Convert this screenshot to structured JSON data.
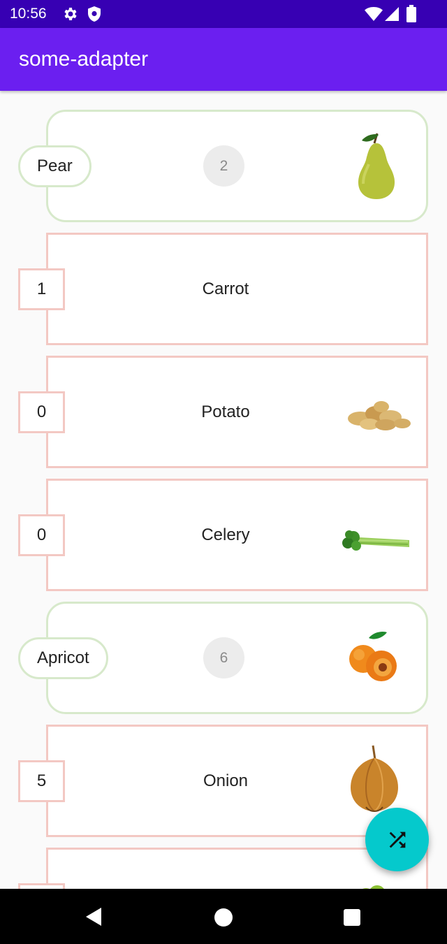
{
  "status_bar": {
    "time": "10:56"
  },
  "app_bar": {
    "title": "some-adapter"
  },
  "list": {
    "pear": {
      "tag": "Pear",
      "count": "2",
      "icon": "pear-image"
    },
    "carrot": {
      "tag": "1",
      "name": "Carrot"
    },
    "potato": {
      "tag": "0",
      "name": "Potato",
      "icon": "potato-image"
    },
    "celery": {
      "tag": "0",
      "name": "Celery",
      "icon": "celery-image"
    },
    "apricot": {
      "tag": "Apricot",
      "count": "6",
      "icon": "apricot-image"
    },
    "onion": {
      "tag": "5",
      "name": "Onion",
      "icon": "onion-image"
    },
    "partial": {
      "icon": "lettuce-image"
    }
  },
  "fab": {
    "icon": "shuffle-icon"
  },
  "colors": {
    "status_bar": "#3700b3",
    "app_bar": "#6b1ff0",
    "fab": "#05c9cc",
    "vegetable_border": "#f3c8c3",
    "fruit_border": "#d7e9cb"
  }
}
